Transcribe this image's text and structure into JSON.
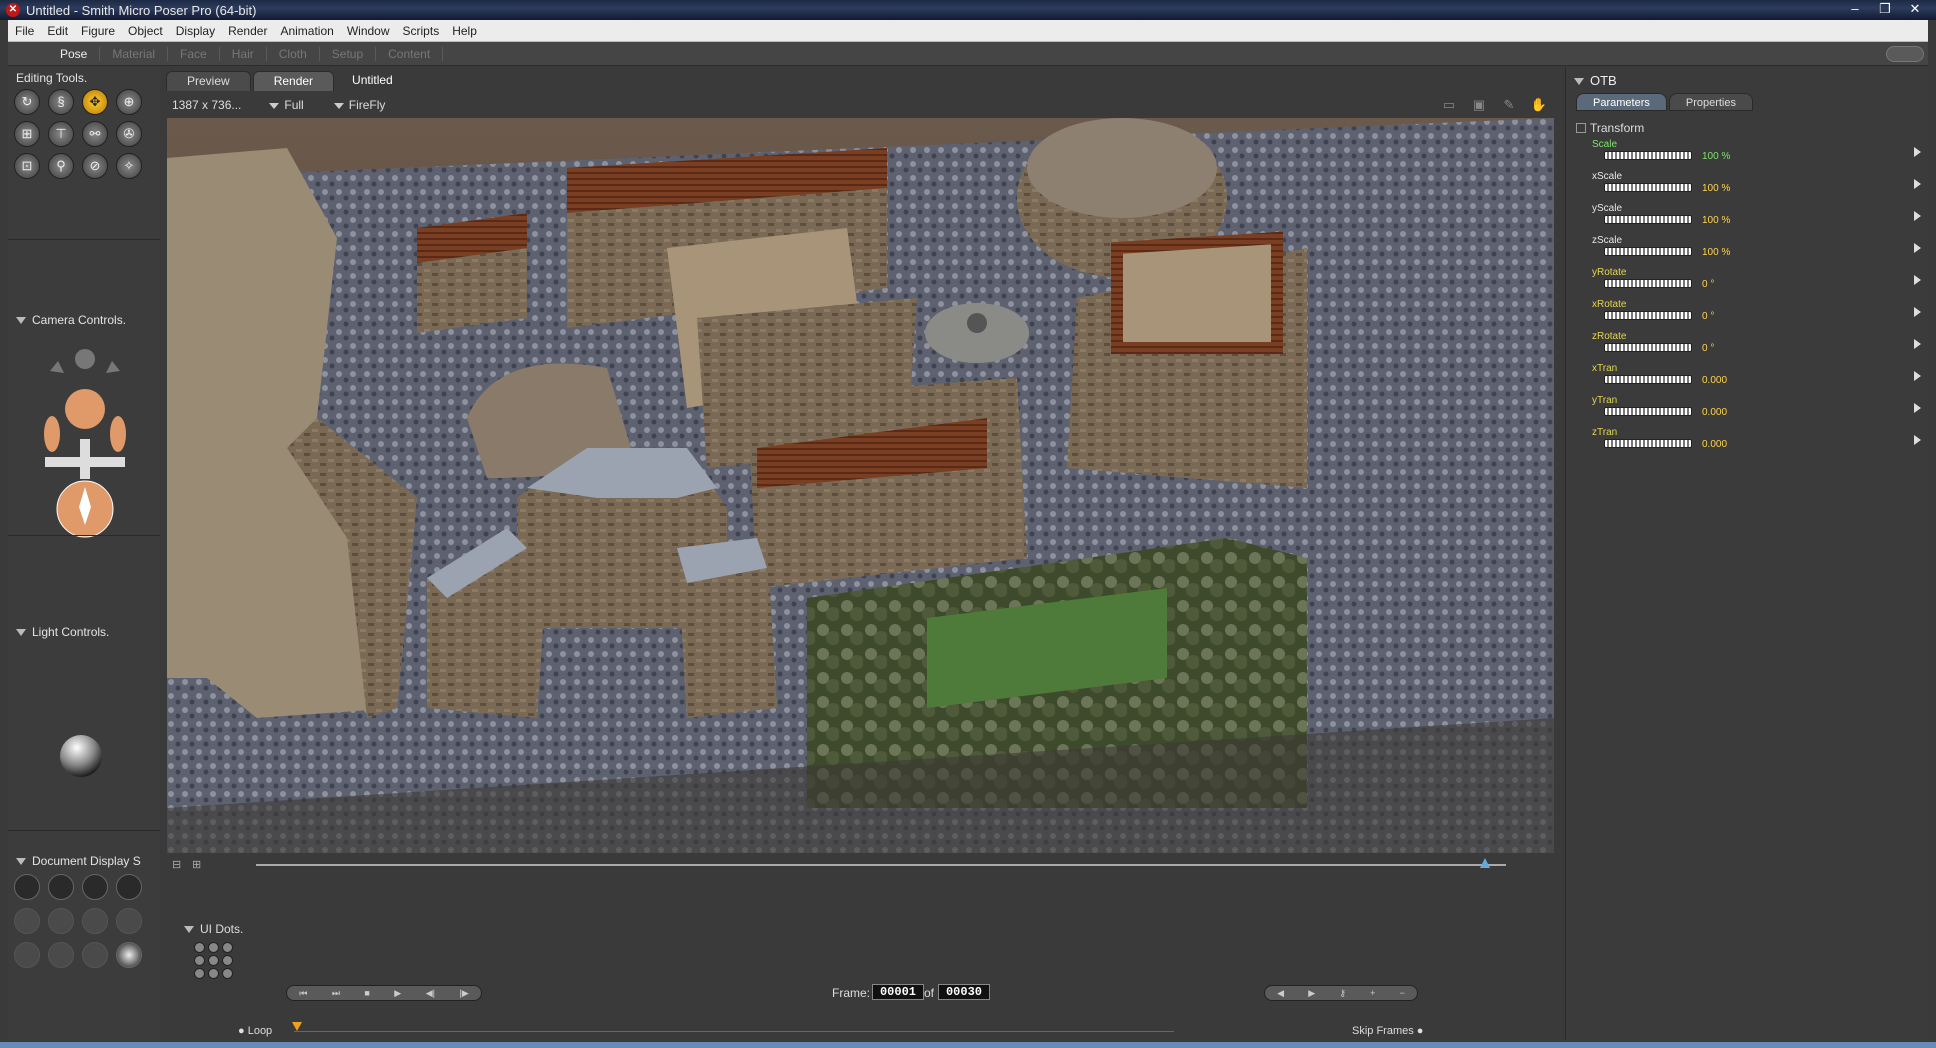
{
  "window": {
    "title": "Untitled - Smith Micro Poser Pro  (64-bit)",
    "controls": [
      "–",
      "❐",
      "✕"
    ]
  },
  "menu": [
    "File",
    "Edit",
    "Figure",
    "Object",
    "Display",
    "Render",
    "Animation",
    "Window",
    "Scripts",
    "Help"
  ],
  "rooms": [
    {
      "label": "Pose",
      "active": true
    },
    {
      "label": "Material",
      "active": false
    },
    {
      "label": "Face",
      "active": false
    },
    {
      "label": "Hair",
      "active": false
    },
    {
      "label": "Cloth",
      "active": false
    },
    {
      "label": "Setup",
      "active": false
    },
    {
      "label": "Content",
      "active": false
    }
  ],
  "left": {
    "editing_tools": "Editing Tools.",
    "tools": [
      "rotate-icon",
      "twist-icon",
      "translate-icon",
      "translate-in-out-icon",
      "scale-icon",
      "taper-icon",
      "chain-break-icon",
      "color-icon",
      "grouping-icon",
      "view-magnifier-icon",
      "morphing-icon",
      "direct-manipulation-icon"
    ],
    "tool_glyphs": [
      "↻",
      "§",
      "✥",
      "⊕",
      "⊞",
      "⊤",
      "⚯",
      "✇",
      "⊡",
      "⚲",
      "⊘",
      "✧"
    ],
    "camera_controls": "Camera Controls.",
    "light_controls": "Light Controls.",
    "document_display": "Document Display S"
  },
  "doc": {
    "tabs": [
      "Preview",
      "Render"
    ],
    "title": "Untitled",
    "resolution": "1387 x 736...",
    "area": "Full",
    "renderer": "FireFly"
  },
  "params": {
    "object": "OTB",
    "tabs": [
      "Parameters",
      "Properties"
    ],
    "group": "Transform",
    "items": [
      {
        "name": "Scale",
        "value": "100 %",
        "hl": "green"
      },
      {
        "name": "xScale",
        "value": "100 %",
        "hl": ""
      },
      {
        "name": "yScale",
        "value": "100 %",
        "hl": ""
      },
      {
        "name": "zScale",
        "value": "100 %",
        "hl": ""
      },
      {
        "name": "yRotate",
        "value": "0 °",
        "hl": "yellow"
      },
      {
        "name": "xRotate",
        "value": "0 °",
        "hl": "yellow"
      },
      {
        "name": "zRotate",
        "value": "0 °",
        "hl": "yellow"
      },
      {
        "name": "xTran",
        "value": "0.000",
        "hl": "yellow"
      },
      {
        "name": "yTran",
        "value": "0.000",
        "hl": "yellow"
      },
      {
        "name": "zTran",
        "value": "0.000",
        "hl": "yellow"
      }
    ]
  },
  "anim": {
    "ui_dots": "UI Dots.",
    "frame_label": "Frame:",
    "frame": "00001",
    "of": "of",
    "total": "00030",
    "loop": "Loop",
    "skip": "Skip Frames"
  }
}
